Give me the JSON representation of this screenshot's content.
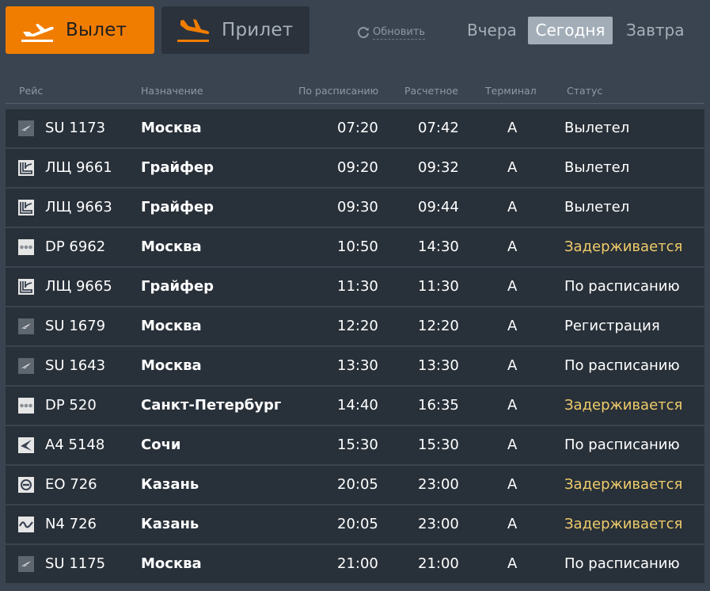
{
  "tabs": {
    "departure": "Вылет",
    "arrival": "Прилет"
  },
  "refresh_label": "Обновить",
  "days": {
    "yesterday": "Вчера",
    "today": "Сегодня",
    "tomorrow": "Завтра"
  },
  "columns": {
    "flight": "Рейс",
    "destination": "Назначение",
    "scheduled": "По расписанию",
    "estimated": "Расчетное",
    "terminal": "Терминал",
    "status": "Статус"
  },
  "colors": {
    "accent": "#f17d00",
    "delayed": "#efcc6a",
    "row_bg": "#283039",
    "page_bg": "#3a4450"
  },
  "flights": [
    {
      "logo": "aeroflot-logo",
      "flight": "SU 1173",
      "destination": "Москва",
      "scheduled": "07:20",
      "estimated": "07:42",
      "terminal": "A",
      "status": "Вылетел",
      "delayed": false
    },
    {
      "logo": "lukoil-logo",
      "flight": "ЛЩ 9661",
      "destination": "Грайфер",
      "scheduled": "09:20",
      "estimated": "09:32",
      "terminal": "A",
      "status": "Вылетел",
      "delayed": false
    },
    {
      "logo": "lukoil-logo",
      "flight": "ЛЩ 9663",
      "destination": "Грайфер",
      "scheduled": "09:30",
      "estimated": "09:44",
      "terminal": "A",
      "status": "Вылетел",
      "delayed": false
    },
    {
      "logo": "pobeda-logo",
      "flight": "DP 6962",
      "destination": "Москва",
      "scheduled": "10:50",
      "estimated": "14:30",
      "terminal": "A",
      "status": "Задерживается",
      "delayed": true
    },
    {
      "logo": "lukoil-logo",
      "flight": "ЛЩ 9665",
      "destination": "Грайфер",
      "scheduled": "11:30",
      "estimated": "11:30",
      "terminal": "A",
      "status": "По расписанию",
      "delayed": false
    },
    {
      "logo": "aeroflot-logo",
      "flight": "SU 1679",
      "destination": "Москва",
      "scheduled": "12:20",
      "estimated": "12:20",
      "terminal": "A",
      "status": "Регистрация",
      "delayed": false
    },
    {
      "logo": "aeroflot-logo",
      "flight": "SU 1643",
      "destination": "Москва",
      "scheduled": "13:30",
      "estimated": "13:30",
      "terminal": "A",
      "status": "По расписанию",
      "delayed": false
    },
    {
      "logo": "pobeda-logo",
      "flight": "DP 520",
      "destination": "Санкт-Петербург",
      "scheduled": "14:40",
      "estimated": "16:35",
      "terminal": "A",
      "status": "Задерживается",
      "delayed": true
    },
    {
      "logo": "alrosa-logo",
      "flight": "A4 5148",
      "destination": "Сочи",
      "scheduled": "15:30",
      "estimated": "15:30",
      "terminal": "A",
      "status": "По расписанию",
      "delayed": false
    },
    {
      "logo": "rotor-logo",
      "flight": "EO 726",
      "destination": "Казань",
      "scheduled": "20:05",
      "estimated": "23:00",
      "terminal": "A",
      "status": "Задерживается",
      "delayed": true
    },
    {
      "logo": "wave-logo",
      "flight": "N4 726",
      "destination": "Казань",
      "scheduled": "20:05",
      "estimated": "23:00",
      "terminal": "A",
      "status": "Задерживается",
      "delayed": true
    },
    {
      "logo": "aeroflot-logo",
      "flight": "SU 1175",
      "destination": "Москва",
      "scheduled": "21:00",
      "estimated": "21:00",
      "terminal": "A",
      "status": "По расписанию",
      "delayed": false
    }
  ]
}
